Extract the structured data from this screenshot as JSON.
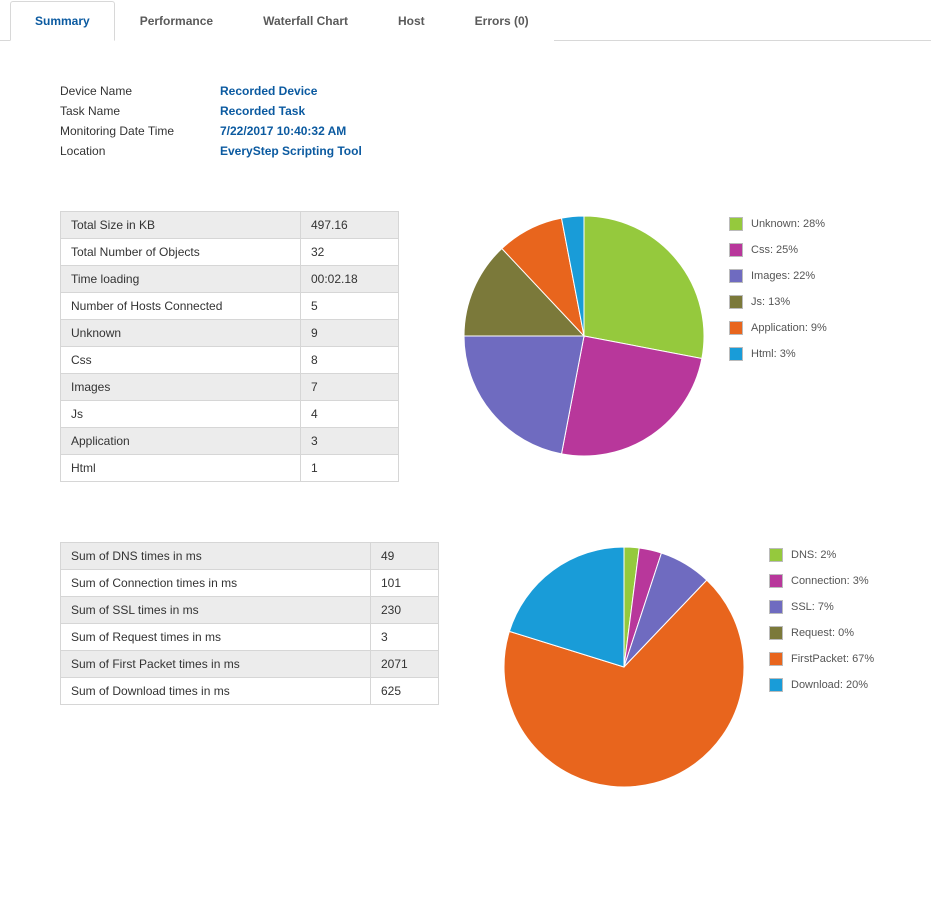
{
  "tabs": [
    {
      "label": "Summary",
      "active": true
    },
    {
      "label": "Performance",
      "active": false
    },
    {
      "label": "Waterfall Chart",
      "active": false
    },
    {
      "label": "Host",
      "active": false
    },
    {
      "label": "Errors (0)",
      "active": false
    }
  ],
  "info": {
    "device_name_label": "Device Name",
    "device_name_value": "Recorded Device",
    "task_name_label": "Task Name",
    "task_name_value": "Recorded Task",
    "monitoring_date_time_label": "Monitoring Date Time",
    "monitoring_date_time_value": "7/22/2017 10:40:32 AM",
    "location_label": "Location",
    "location_value": "EveryStep Scripting Tool"
  },
  "objects_table": [
    {
      "label": "Total Size in KB",
      "value": "497.16"
    },
    {
      "label": "Total Number of Objects",
      "value": "32"
    },
    {
      "label": "Time loading",
      "value": "00:02.18"
    },
    {
      "label": "Number of Hosts Connected",
      "value": "5"
    },
    {
      "label": "Unknown",
      "value": "9"
    },
    {
      "label": "Css",
      "value": "8"
    },
    {
      "label": "Images",
      "value": "7"
    },
    {
      "label": "Js",
      "value": "4"
    },
    {
      "label": "Application",
      "value": "3"
    },
    {
      "label": "Html",
      "value": "1"
    }
  ],
  "times_table": [
    {
      "label": "Sum of DNS times in ms",
      "value": "49"
    },
    {
      "label": "Sum of Connection times in ms",
      "value": "101"
    },
    {
      "label": "Sum of SSL times in ms",
      "value": "230"
    },
    {
      "label": "Sum of Request times in ms",
      "value": "3"
    },
    {
      "label": "Sum of First Packet times in ms",
      "value": "2071"
    },
    {
      "label": "Sum of Download times in ms",
      "value": "625"
    }
  ],
  "colors": {
    "green": "#95c93d",
    "magenta": "#b8379b",
    "purple": "#6f6bc0",
    "olive": "#7b793a",
    "orange": "#e8651d",
    "blue": "#199cd8"
  },
  "chart_data": [
    {
      "type": "pie",
      "title": "",
      "series": [
        {
          "name": "Unknown",
          "value": 28,
          "color": "green"
        },
        {
          "name": "Css",
          "value": 25,
          "color": "magenta"
        },
        {
          "name": "Images",
          "value": 22,
          "color": "purple"
        },
        {
          "name": "Js",
          "value": 13,
          "color": "olive"
        },
        {
          "name": "Application",
          "value": 9,
          "color": "orange"
        },
        {
          "name": "Html",
          "value": 3,
          "color": "blue"
        }
      ],
      "legend_suffix": "%"
    },
    {
      "type": "pie",
      "title": "",
      "series": [
        {
          "name": "DNS",
          "value": 2,
          "color": "green"
        },
        {
          "name": "Connection",
          "value": 3,
          "color": "magenta"
        },
        {
          "name": "SSL",
          "value": 7,
          "color": "purple"
        },
        {
          "name": "Request",
          "value": 0,
          "color": "olive"
        },
        {
          "name": "FirstPacket",
          "value": 67,
          "color": "orange"
        },
        {
          "name": "Download",
          "value": 20,
          "color": "blue"
        }
      ],
      "legend_suffix": "%"
    }
  ]
}
